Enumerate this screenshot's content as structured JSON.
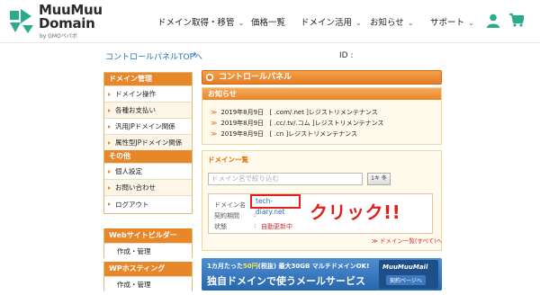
{
  "header": {
    "logo_line1": "MuuMuu",
    "logo_line2": "Domain",
    "logo_sub": "by GMOペパボ",
    "nav": [
      {
        "label": "ドメイン取得・移管",
        "has_chevron": true
      },
      {
        "label": "価格一覧",
        "has_chevron": false
      },
      {
        "label": "ドメイン活用",
        "has_chevron": true
      },
      {
        "label": "お知らせ",
        "has_chevron": true
      },
      {
        "label": "サポート",
        "has_chevron": true
      }
    ],
    "chevron_glyph": "⌄",
    "icons": [
      "user-icon",
      "cart-icon"
    ],
    "accent_color": "#2bab8c"
  },
  "top_link": {
    "label": "コントロールパネルTOPへ",
    "arrow": "→"
  },
  "id_label": "ID :",
  "sidebar": {
    "domain_section": {
      "title": "ドメイン管理",
      "items": [
        "ドメイン操作",
        "各種お支払い",
        "汎用JPドメイン関係",
        "属性型JPドメイン関係"
      ]
    },
    "other_section": {
      "title": "その他",
      "items": [
        "個人設定",
        "お問い合わせ",
        "ログアウト"
      ]
    },
    "web_builder": {
      "title": "Webサイトビルダー",
      "item": "作成・管理"
    },
    "wp_hosting": {
      "title": "WPホスティング",
      "item": "作成・管理"
    }
  },
  "control_panel": {
    "title": "コントロールパネル",
    "notice": {
      "title": "お知らせ",
      "items": [
        {
          "date": "2019年8月9日",
          "text": "[ .com/.net ]レジストリメンテナンス"
        },
        {
          "date": "2019年8月9日",
          "text": "[ .cc/.tv/.コム ]レジストリメンテナンス"
        },
        {
          "date": "2019年8月9日",
          "text": "[ .cn ]レジストリメンテナンス"
        }
      ]
    },
    "domains": {
      "title": "ドメイン一覧",
      "search_placeholder": "ドメイン名で絞り込む",
      "search_button": "1キ 冬",
      "rows": [
        {
          "label": "ドメイン名",
          "value": "tech-diary.net"
        },
        {
          "label": "契約期間",
          "value": ""
        },
        {
          "label": "状態",
          "value": "自動更新中"
        }
      ],
      "view_all": "≫ ドメイン一覧(すべて)へ"
    },
    "annotation": "クリック!!"
  },
  "banner": {
    "line1_a": "1カ月たった",
    "line1_b": "50円",
    "line1_c": "(税抜) 最大30GB マルチドメインOK!",
    "line2": "独自ドメインで使うメールサービス",
    "side_title": "MuuMuuMail",
    "side_button": "契約ページへ"
  }
}
